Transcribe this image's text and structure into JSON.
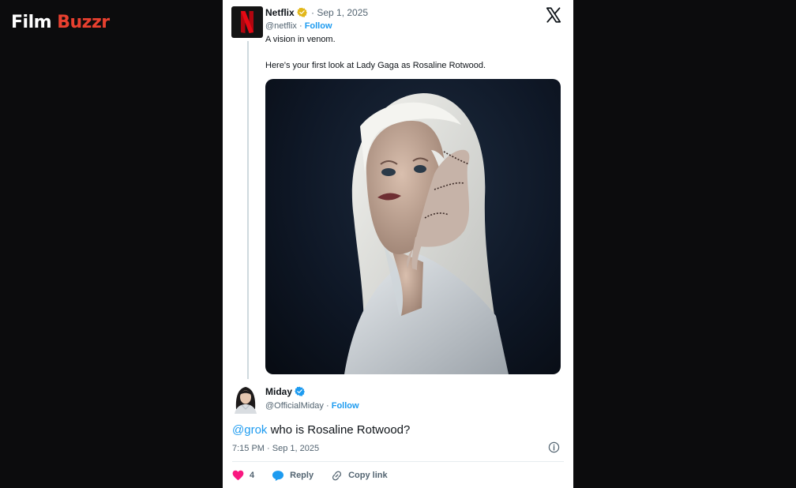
{
  "site": {
    "logo_first": "Film",
    "logo_second": "Buzzr",
    "accent": "#e8402f"
  },
  "tweet": {
    "author": "Netflix",
    "handle": "@netflix",
    "date": "Sep 1, 2025",
    "follow": "Follow",
    "line1": "A vision in venom.",
    "line2": "Here's your first look at Lady Gaga as Rosaline Rotwood.",
    "avatar_letter": "N",
    "brand_color": "#e50914"
  },
  "reply": {
    "author": "Miday",
    "handle": "@OfficialMiday",
    "follow": "Follow",
    "mention": "@grok",
    "text": " who is Rosaline Rotwood?",
    "timestamp": "7:15 PM · Sep 1, 2025"
  },
  "actions": {
    "likes": "4",
    "reply_label": "Reply",
    "copy_label": "Copy link"
  },
  "colors": {
    "link": "#1d9bf0",
    "like": "#f91880",
    "gold_badge": "#e2b719"
  },
  "icons": [
    "verified-gold-badge",
    "verified-blue-badge",
    "x-logo-icon",
    "info-icon",
    "heart-icon",
    "reply-bubble-icon",
    "link-icon"
  ]
}
